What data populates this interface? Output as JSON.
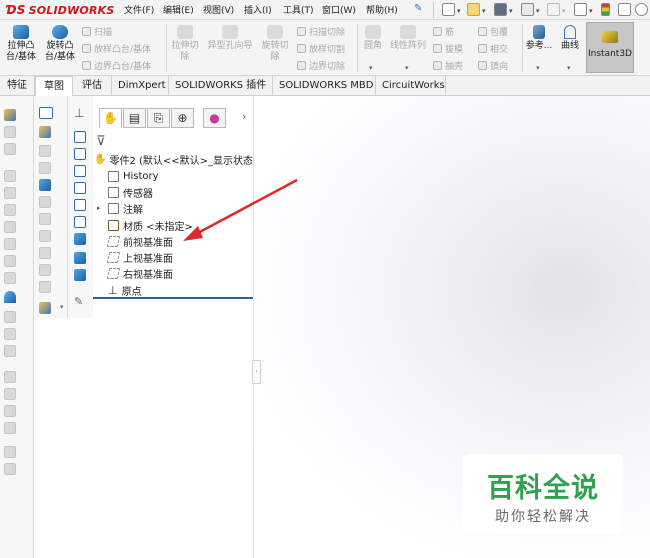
{
  "app": {
    "logo_text": "SOLIDWORKS"
  },
  "menubar": {
    "items": [
      "文件(F)",
      "编辑(E)",
      "视图(V)",
      "插入(I)",
      "工具(T)",
      "窗口(W)",
      "帮助(H)"
    ]
  },
  "command_manager": {
    "extrude_boss": "拉伸凸台/基体",
    "revolve_boss": "旋转凸台/基体",
    "sweep": "扫描",
    "loft_boss": "放样凸台/基体",
    "boundary_boss": "边界凸台/基体",
    "extrude_cut": "拉伸切除",
    "hole_wizard": "异型孔向导",
    "revolve_cut": "旋转切除",
    "swept_cut": "扫描切除",
    "lofted_cut": "放样切割",
    "boundary_cut": "边界切除",
    "fillet": "圆角",
    "linear_pattern": "线性阵列",
    "rib": "筋",
    "draft": "拔模",
    "shell": "抽壳",
    "wrap": "包覆",
    "intersect": "相交",
    "mirror": "镜向",
    "reference": "参考...",
    "curves": "曲线",
    "instant3d": "Instant3D"
  },
  "tabs": [
    "特征",
    "草图",
    "评估",
    "DimXpert",
    "SOLIDWORKS 插件",
    "SOLIDWORKS MBD",
    "CircuitWorks"
  ],
  "feature_tree": {
    "root": "零件2 (默认<<默认>_显示状态",
    "items": [
      "History",
      "传感器",
      "注解",
      "材质 <未指定>",
      "前视基准面",
      "上视基准面",
      "右视基准面",
      "原点"
    ]
  },
  "watermark": {
    "title": "百科全说",
    "subtitle": "助你轻松解决"
  },
  "colors": {
    "accent_red": "#e0282e",
    "logo_red": "#d0151b",
    "watermark_green": "#2ea24f",
    "rollback_blue": "#2f5fa8"
  }
}
